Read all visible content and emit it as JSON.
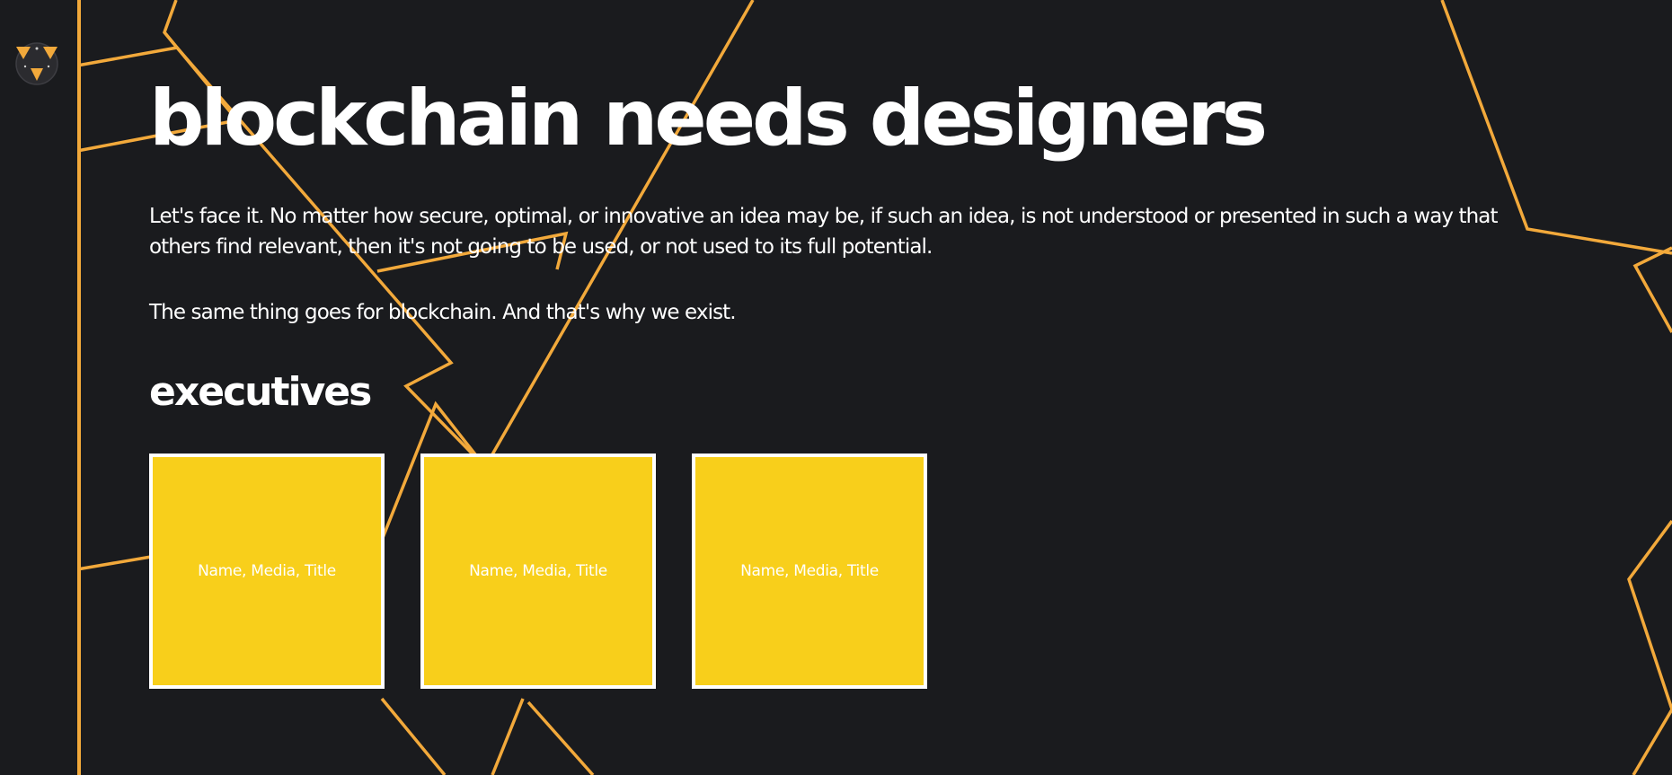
{
  "page": {
    "headline": "blockchain needs designers",
    "intro_paragraph": "Let's face it. No matter how secure, optimal, or innovative an idea may be, if such an idea, is not understood or presented in such a way that others find relevant, then it's not going to be used, or not used to its full potential.",
    "intro_paragraph_2": "The same thing goes for blockchain. And that's why we exist.",
    "section_title": "executives"
  },
  "executives": [
    {
      "label": "Name, Media, Title"
    },
    {
      "label": "Name, Media, Title"
    },
    {
      "label": "Name, Media, Title"
    }
  ],
  "colors": {
    "background": "#1a1b1e",
    "accent_line": "#f2a93b",
    "card_fill": "#f8cf1b",
    "card_border": "#ffffff",
    "text": "#ffffff"
  },
  "icons": {
    "logo": "triangle-logo-icon"
  }
}
